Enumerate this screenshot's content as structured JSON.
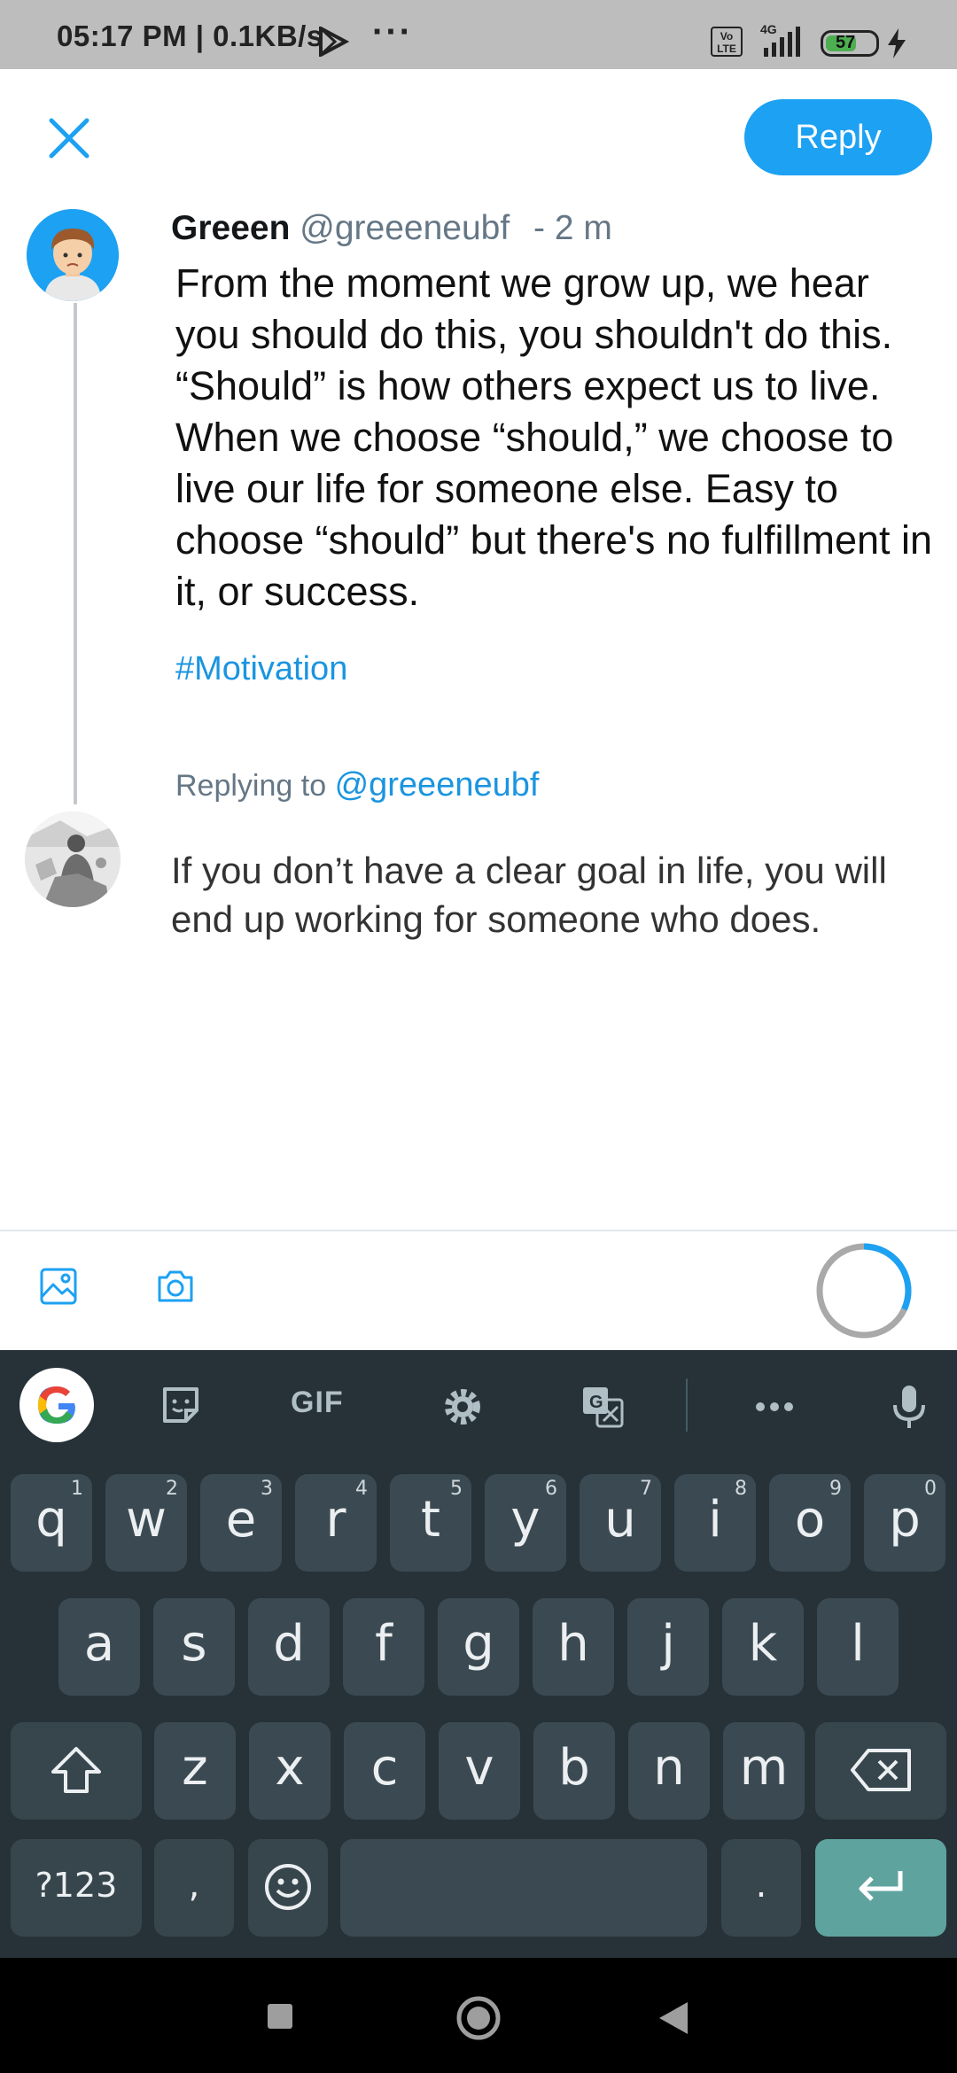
{
  "status_bar": {
    "time": "05:17 PM | 0.1KB/s",
    "dots": "···",
    "volte": "Vo LTE",
    "network": "4G",
    "battery": "57"
  },
  "compose": {
    "reply_button": "Reply"
  },
  "original_tweet": {
    "display_name": "Greeen",
    "handle": "@greeeneubf",
    "time": "- 2 m",
    "body": "From the moment we grow up, we hear you should do this, you shouldn't do this. “Should” is how others expect us to live. When we choose “should,” we choose to live our life for someone else. Easy to choose “should” but there's no fulfillment in it, or success.",
    "hashtag": "#Motivation"
  },
  "reply": {
    "replying_to_label": "Replying to",
    "replying_to_handle": "@greeeneubf",
    "draft_text": "If you don’t have a clear goal in life, you will end up working for someone who does."
  },
  "keyboard": {
    "gif_label": "GIF",
    "row1": [
      "q",
      "w",
      "e",
      "r",
      "t",
      "y",
      "u",
      "i",
      "o",
      "p"
    ],
    "row1_hints": [
      "1",
      "2",
      "3",
      "4",
      "5",
      "6",
      "7",
      "8",
      "9",
      "0"
    ],
    "row2": [
      "a",
      "s",
      "d",
      "f",
      "g",
      "h",
      "j",
      "k",
      "l"
    ],
    "row3": [
      "z",
      "x",
      "c",
      "v",
      "b",
      "n",
      "m"
    ],
    "symbols_key": "?123",
    "comma_key": ",",
    "period_key": "."
  },
  "colors": {
    "accent": "#1da1f2",
    "keyboard_bg": "#263238",
    "key_bg": "#3b4a52",
    "enter_key": "#5fa39f"
  }
}
